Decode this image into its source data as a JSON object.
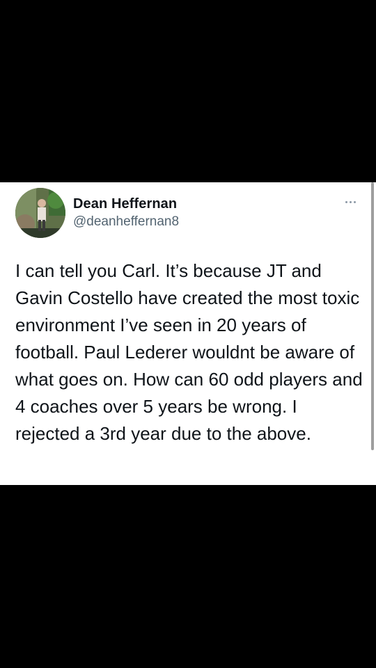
{
  "tweet": {
    "display_name": "Dean Heffernan",
    "handle": "@deanheffernan8",
    "more_icon": "more-horizontal-icon",
    "text": "I can tell you Carl. It’s because JT and Gavin Costello have created the most toxic environment I’ve seen in 20 years of football. Paul Lederer wouldnt be aware of what goes on. How can 60 odd players and 4 coaches over 5 years be wrong. I rejected a 3rd year due to the above."
  },
  "colors": {
    "background": "#000000",
    "card": "#ffffff",
    "name_text": "#0f1419",
    "handle_text": "#536471",
    "icon_gray": "#8b98a5"
  }
}
